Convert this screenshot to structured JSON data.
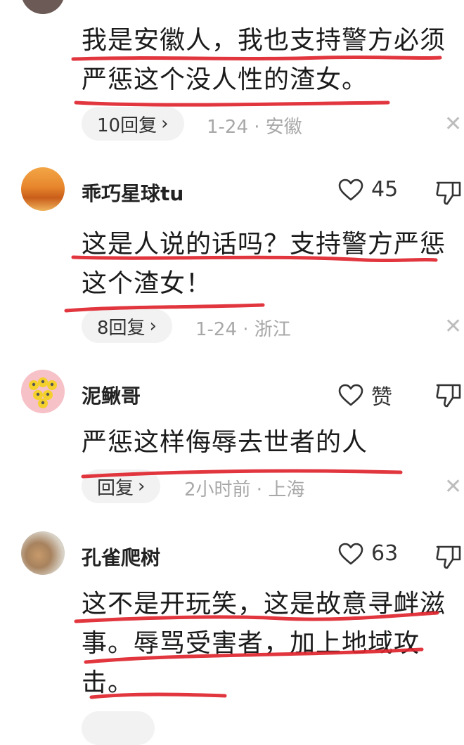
{
  "comments": [
    {
      "username": "",
      "text": "我是安徽人，我也支持警方必须严惩这个没人性的渣女。",
      "reply_label": "10回复",
      "meta": "1-24 · 安徽"
    },
    {
      "username": "乖巧星球tu",
      "likes": "45",
      "text": "这是人说的话吗？支持警方严惩这个渣女！",
      "reply_label": "8回复",
      "meta": "1-24 · 浙江"
    },
    {
      "username": "泥鳅哥",
      "likes": "赞",
      "text": "严惩这样侮辱去世者的人",
      "reply_label": "回复",
      "meta": "2小时前 · 上海"
    },
    {
      "username": "孔雀爬树",
      "likes": "63",
      "text": "这不是开玩笑，这是故意寻衅滋事。辱骂受害者，加上地域攻击。"
    }
  ],
  "icons": {
    "like": "heart-outline-icon",
    "dislike": "thumbs-down-icon",
    "close": "close-icon",
    "chevron": "chevron-right-icon"
  },
  "colors": {
    "annotation": "#e0252f",
    "meta_text": "#a8a8a8",
    "pill_bg": "#f2f2f2"
  }
}
